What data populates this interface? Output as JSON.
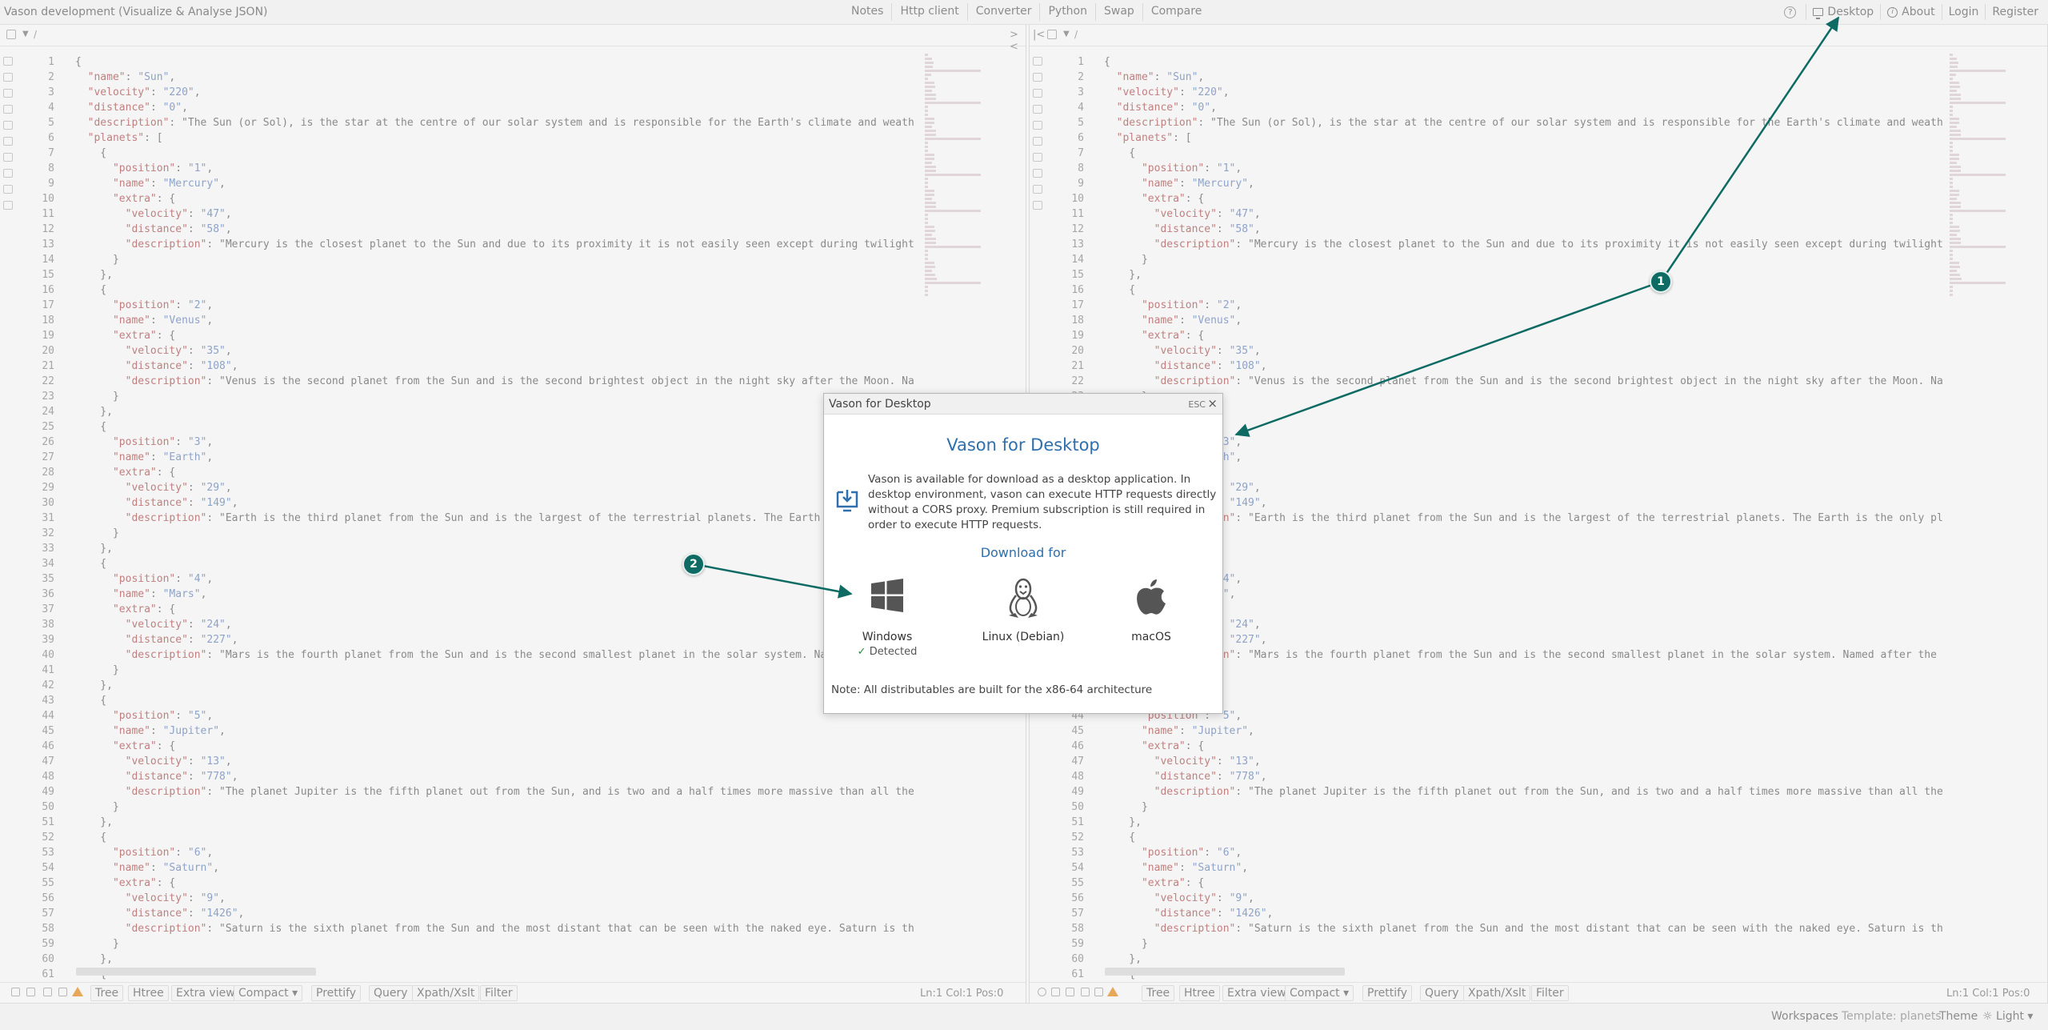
{
  "app": {
    "title": "Vason development (Visualize & Analyse JSON)"
  },
  "top_nav": [
    "Notes",
    "Http client",
    "Converter",
    "Python",
    "Swap",
    "Compare"
  ],
  "top_right": {
    "help": "?",
    "desktop": "Desktop",
    "about": "About",
    "login": "Login",
    "register": "Register"
  },
  "editor": {
    "path": "/",
    "lines": [
      "{",
      "  \"name\": \"Sun\",",
      "  \"velocity\": \"220\",",
      "  \"distance\": \"0\",",
      "  \"description\": \"The Sun (or Sol), is the star at the centre of our solar system and is responsible for the Earth's climate and weather",
      "  \"planets\": [",
      "    {",
      "      \"position\": \"1\",",
      "      \"name\": \"Mercury\",",
      "      \"extra\": {",
      "        \"velocity\": \"47\",",
      "        \"distance\": \"58\",",
      "        \"description\": \"Mercury is the closest planet to the Sun and due to its proximity it is not easily seen except during twilight. F",
      "      }",
      "    },",
      "    {",
      "      \"position\": \"2\",",
      "      \"name\": \"Venus\",",
      "      \"extra\": {",
      "        \"velocity\": \"35\",",
      "        \"distance\": \"108\",",
      "        \"description\": \"Venus is the second planet from the Sun and is the second brightest object in the night sky after the Moon. Named",
      "      }",
      "    },",
      "    {",
      "      \"position\": \"3\",",
      "      \"name\": \"Earth\",",
      "      \"extra\": {",
      "        \"velocity\": \"29\",",
      "        \"distance\": \"149\",",
      "        \"description\": \"Earth is the third planet from the Sun and is the largest of the terrestrial planets. The Earth is the only plan",
      "      }",
      "    },",
      "    {",
      "      \"position\": \"4\",",
      "      \"name\": \"Mars\",",
      "      \"extra\": {",
      "        \"velocity\": \"24\",",
      "        \"distance\": \"227\",",
      "        \"description\": \"Mars is the fourth planet from the Sun and is the second smallest planet in the solar system. Named after the Ro",
      "      }",
      "    },",
      "    {",
      "      \"position\": \"5\",",
      "      \"name\": \"Jupiter\",",
      "      \"extra\": {",
      "        \"velocity\": \"13\",",
      "        \"distance\": \"778\",",
      "        \"description\": \"The planet Jupiter is the fifth planet out from the Sun, and is two and a half times more massive than all the ot",
      "      }",
      "    },",
      "    {",
      "      \"position\": \"6\",",
      "      \"name\": \"Saturn\",",
      "      \"extra\": {",
      "        \"velocity\": \"9\",",
      "        \"distance\": \"1426\",",
      "        \"description\": \"Saturn is the sixth planet from the Sun and the most distant that can be seen with the naked eye. Saturn is the s",
      "      }",
      "    },",
      "    {"
    ],
    "footer": {
      "tree": "Tree",
      "htree": "Htree",
      "extra_view": "Extra view",
      "compact": "Compact",
      "prettify": "Prettify",
      "query": "Query",
      "xpath": "Xpath/Xslt",
      "filter": "Filter",
      "status": "Ln:1 Col:1 Pos:0"
    }
  },
  "bottom_bar": {
    "workspaces": "Workspaces",
    "template": "Template: planets",
    "theme": "Theme",
    "light": "Light"
  },
  "modal": {
    "title": "Vason for Desktop",
    "esc": "ESC",
    "close": "×",
    "heading": "Vason for Desktop",
    "description": "Vason is available for download as a desktop application. In desktop environment, vason can execute HTTP requests directly without a CORS proxy. Premium subscription is still required in order to execute HTTP requests.",
    "download_for": "Download for",
    "os": [
      {
        "name": "Windows",
        "status": "Detected"
      },
      {
        "name": "Linux (Debian)",
        "status": ""
      },
      {
        "name": "macOS",
        "status": ""
      }
    ],
    "note": "Note: All distributables are built for the x86-64 architecture"
  },
  "annotations": [
    {
      "label": "1"
    },
    {
      "label": "2"
    }
  ],
  "colors": {
    "accent": "#2f6fae",
    "annotation": "#0e6b64",
    "detected": "#2e8a3c",
    "warning": "#e8a85a"
  }
}
